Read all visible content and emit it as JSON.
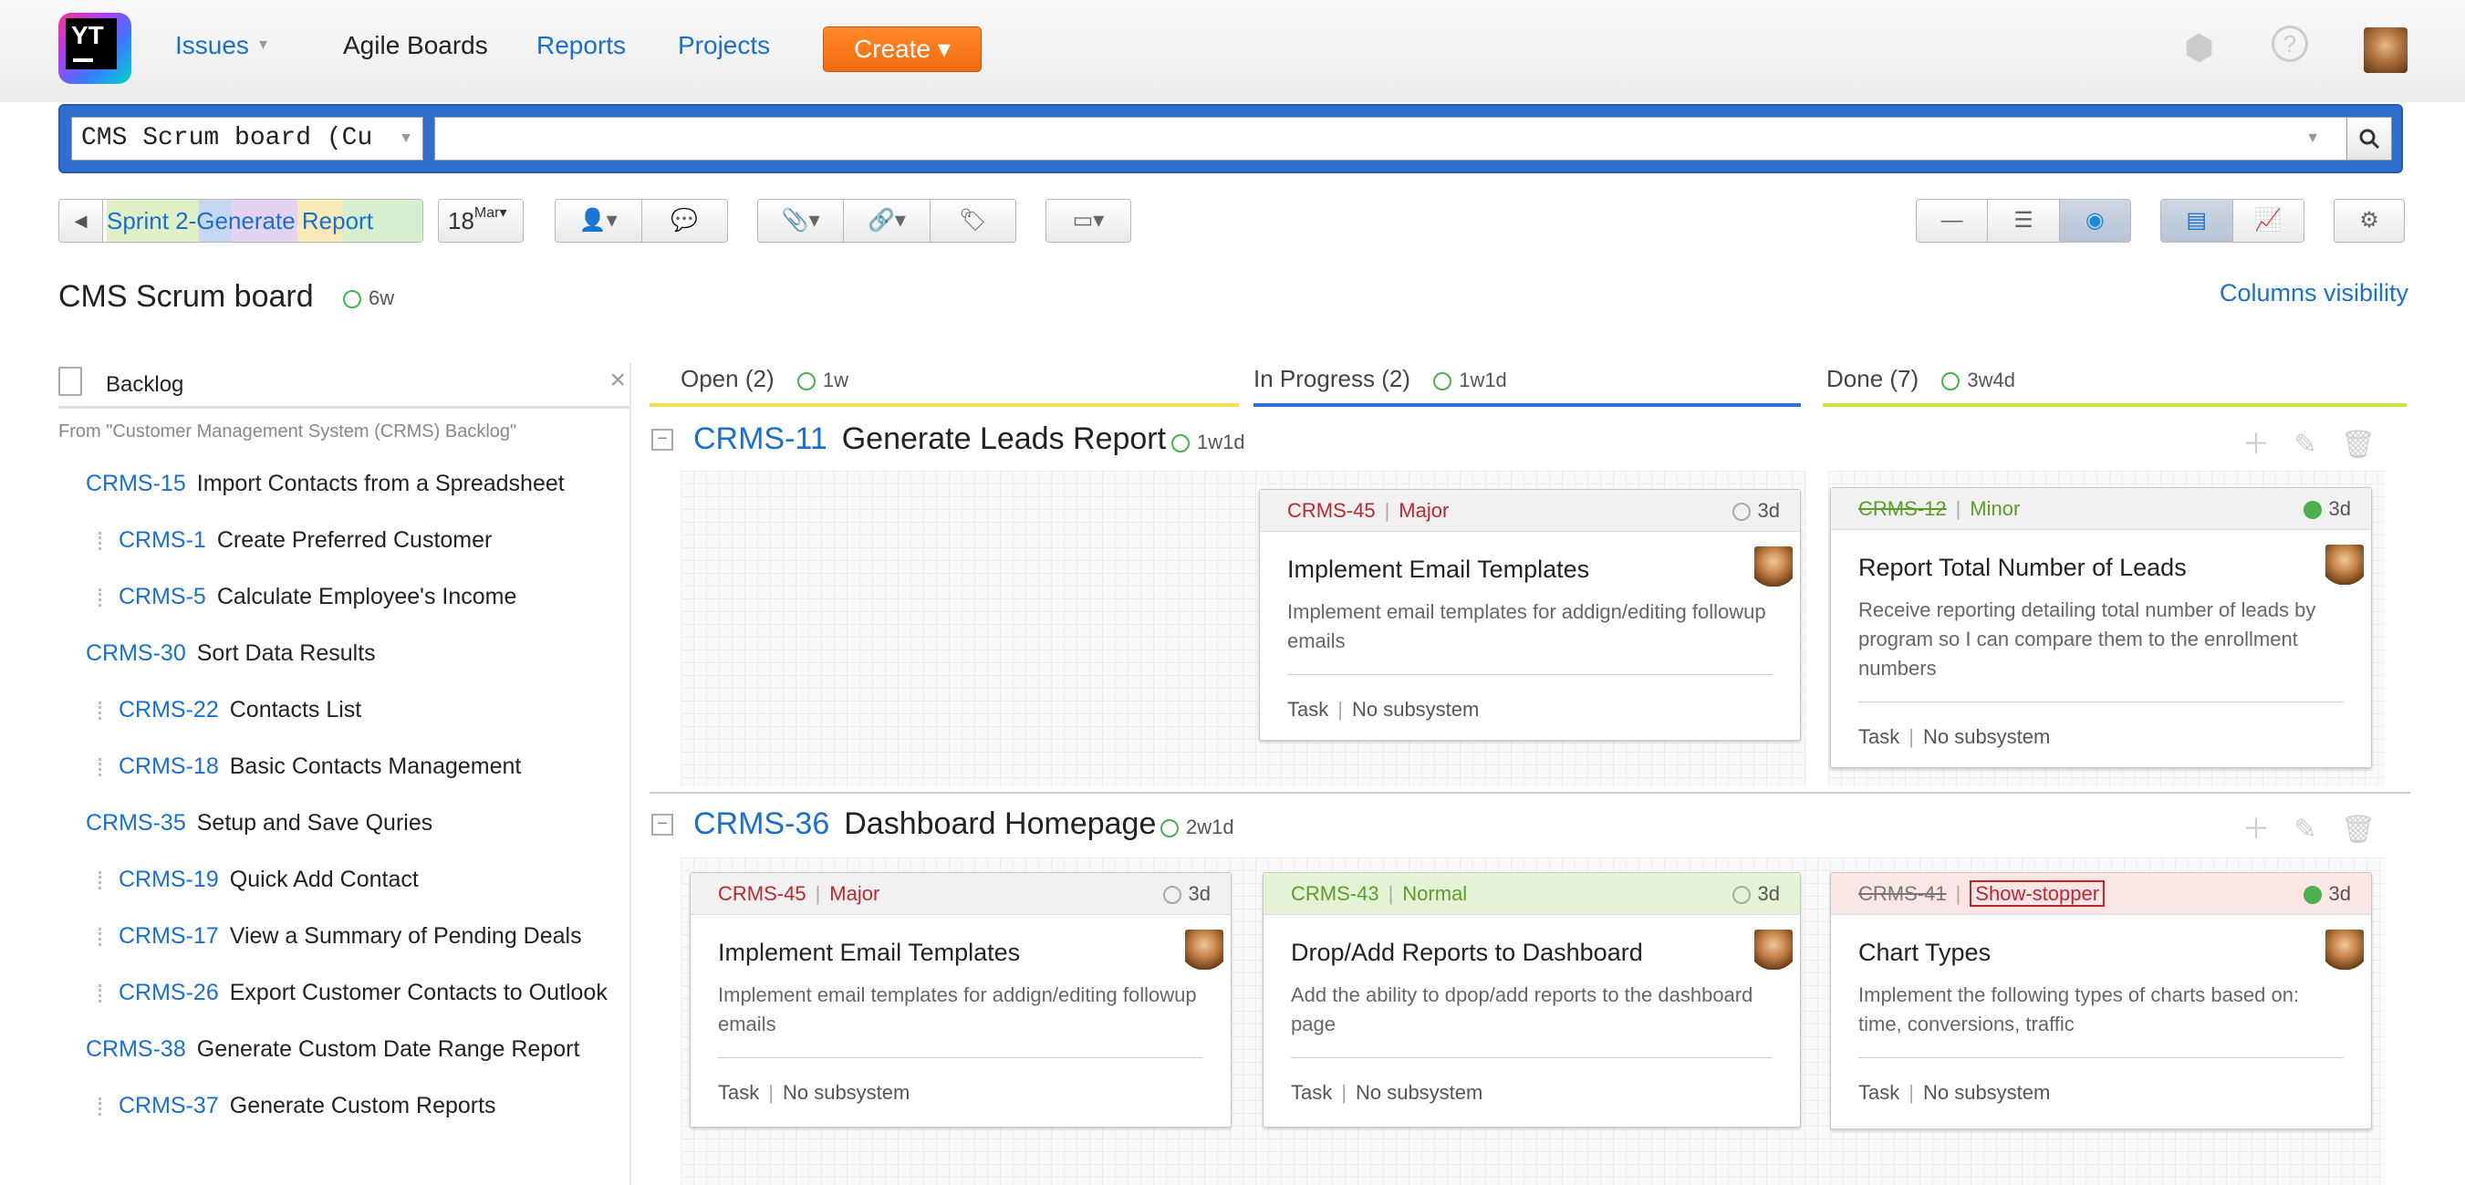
{
  "nav": {
    "issues": "Issues",
    "agile_boards": "Agile Boards",
    "reports": "Reports",
    "projects": "Projects",
    "create": "Create ▾"
  },
  "search": {
    "board_select": "CMS Scrum board (Cu",
    "query": ""
  },
  "toolbar": {
    "sprint": "Sprint 2-Generate Report",
    "date_day": "18",
    "date_month": "Mar"
  },
  "board": {
    "title": "CMS Scrum board",
    "estimate": "6w",
    "columns_visibility": "Columns visibility"
  },
  "backlog": {
    "title": "Backlog",
    "from": "From \"Customer Management System (CRMS) Backlog\"",
    "items": [
      {
        "id": "CRMS-15",
        "text": "Import Contacts from a Spreadsheet",
        "child": false
      },
      {
        "id": "CRMS-1",
        "text": "Create Preferred Customer",
        "child": true
      },
      {
        "id": "CRMS-5",
        "text": "Calculate Employee's Income",
        "child": true
      },
      {
        "id": "CRMS-30",
        "text": "Sort Data Results",
        "child": false
      },
      {
        "id": "CRMS-22",
        "text": "Contacts List",
        "child": true
      },
      {
        "id": "CRMS-18",
        "text": "Basic Contacts Management",
        "child": true
      },
      {
        "id": "CRMS-35",
        "text": "Setup and Save Quries",
        "child": false
      },
      {
        "id": "CRMS-19",
        "text": "Quick Add Contact",
        "child": true
      },
      {
        "id": "CRMS-17",
        "text": "View a Summary of Pending Deals",
        "child": true
      },
      {
        "id": "CRMS-26",
        "text": "Export Customer Contacts to Outlook",
        "child": true
      },
      {
        "id": "CRMS-38",
        "text": "Generate Custom Date Range Report",
        "child": false
      },
      {
        "id": "CRMS-37",
        "text": "Generate Custom Reports",
        "child": true
      }
    ]
  },
  "columns": [
    {
      "name": "Open",
      "count": "(2)",
      "estimate": "1w",
      "color": "#f0e050"
    },
    {
      "name": "In Progress",
      "count": "(2)",
      "estimate": "1w1d",
      "color": "#2f6fcf"
    },
    {
      "name": "Done",
      "count": "(7)",
      "estimate": "3w4d",
      "color": "#c8e640"
    }
  ],
  "swimlanes": [
    {
      "id": "CRMS-11",
      "title": "Generate Leads Report",
      "estimate": "1w1d",
      "cards": [
        {
          "id": "CRMS-45",
          "priority": "Major",
          "estimate": "3d",
          "title": "Implement Email Templates",
          "desc": "Implement email templates for addign/editing followup emails",
          "type": "Task",
          "subsystem": "No subsystem"
        },
        {
          "id": "CRMS-12",
          "priority": "Minor",
          "estimate": "3d",
          "title": "Report Total Number of Leads",
          "desc": "Receive reporting detailing total number of leads by program so I can compare them to the enrollment numbers",
          "type": "Task",
          "subsystem": "No subsystem"
        }
      ]
    },
    {
      "id": "CRMS-36",
      "title": "Dashboard Homepage",
      "estimate": "2w1d",
      "cards": [
        {
          "id": "CRMS-45",
          "priority": "Major",
          "estimate": "3d",
          "title": "Implement Email Templates",
          "desc": "Implement email templates for addign/editing followup emails",
          "type": "Task",
          "subsystem": "No subsystem"
        },
        {
          "id": "CRMS-43",
          "priority": "Normal",
          "estimate": "3d",
          "title": "Drop/Add Reports to Dashboard",
          "desc": "Add the ability to dpop/add reports to the dashboard page",
          "type": "Task",
          "subsystem": "No subsystem"
        },
        {
          "id": "CRMS-41",
          "priority": "Show-stopper",
          "estimate": "3d",
          "title": "Chart Types",
          "desc": "Implement the following types of charts based on: time, conversions, traffic",
          "type": "Task",
          "subsystem": "No subsystem"
        }
      ]
    }
  ]
}
